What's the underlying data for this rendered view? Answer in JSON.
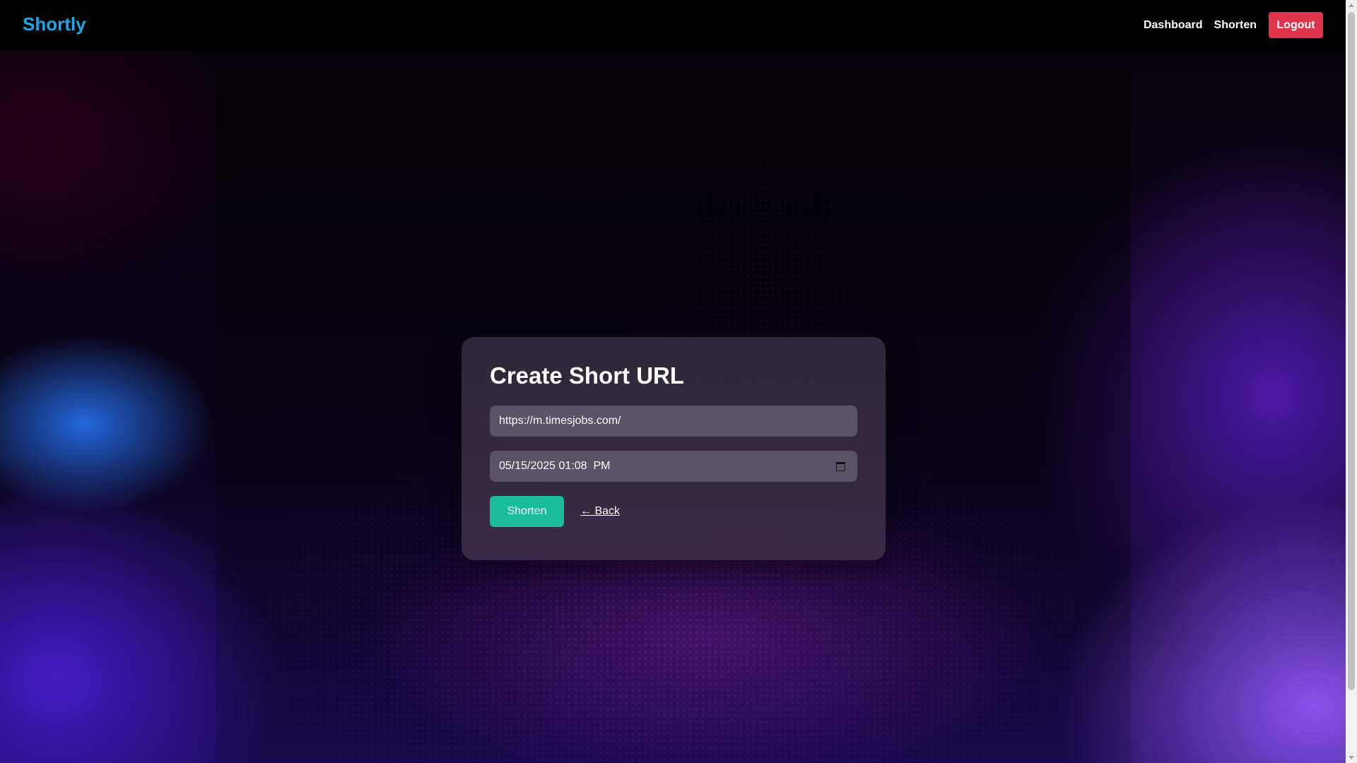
{
  "navbar": {
    "brand": "Shortly",
    "links": [
      {
        "label": "Dashboard"
      },
      {
        "label": "Shorten"
      }
    ],
    "logout_label": "Logout"
  },
  "form": {
    "title": "Create Short URL",
    "url_value": "https://m.timesjobs.com/",
    "expiry_value": "05/15/2025 01:08  PM",
    "submit_label": "Shorten",
    "back_label": "← Back"
  },
  "colors": {
    "brand": "#1aa8e6",
    "logout": "#e0334c",
    "submit": "#1abc9c"
  },
  "icons": {
    "calendar": "calendar-icon"
  }
}
